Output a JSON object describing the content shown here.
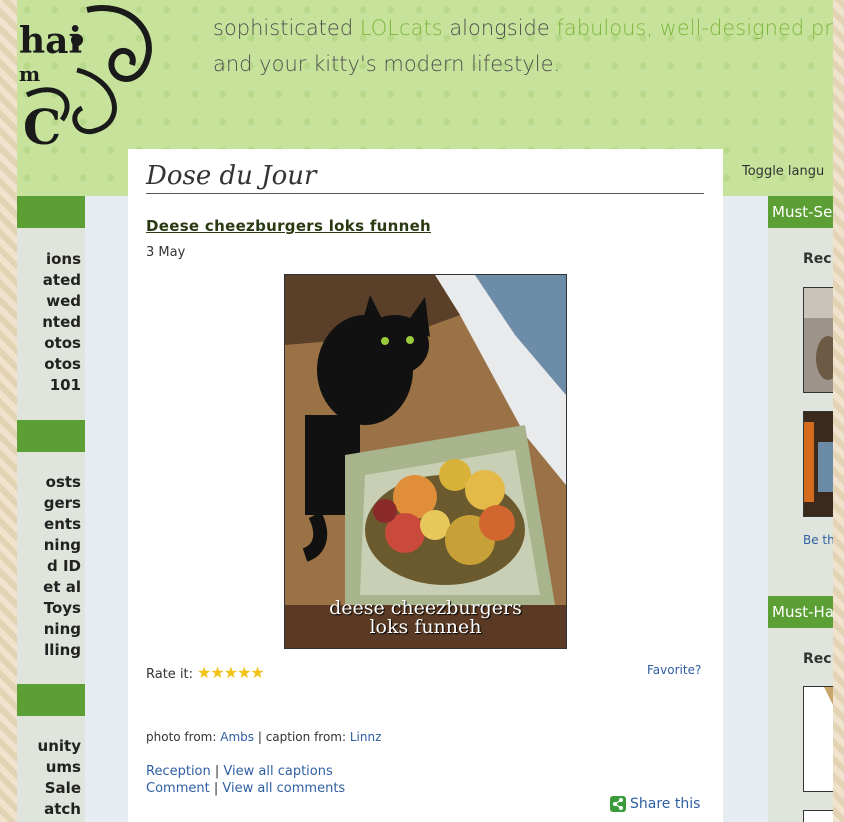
{
  "header": {
    "logo_text": "hai",
    "logo_text2": "m",
    "logo_letter": "C",
    "tagline_line1_a": "sophisticated ",
    "tagline_line1_hl1": "LOLcats",
    "tagline_line1_b": " alongside ",
    "tagline_line1_hl2": "fabulous, well-designed pro",
    "tagline_line2": "and your kitty's modern lifestyle.",
    "toggle_language": "Toggle langu"
  },
  "left_sidebar": {
    "group1": [
      "ions",
      "ated",
      "wed",
      "nted",
      "otos",
      "otos",
      "101"
    ],
    "group2": [
      "osts",
      "gers",
      "ents",
      "ning",
      "d ID",
      "et al",
      "Toys",
      "ning",
      "lling"
    ],
    "group3": [
      "unity",
      "ums",
      "Sale",
      "atch"
    ]
  },
  "main": {
    "section_title": "Dose du Jour",
    "post_title": "Deese cheezburgers loks funneh",
    "post_date": "3 May",
    "photo_caption_line1": "deese cheezburgers",
    "photo_caption_line2": "loks funneh",
    "rate_label": "Rate it:",
    "stars": "★★★★★",
    "favorite": "Favorite?",
    "photo_from_label": "photo from:",
    "photo_from_user": "Ambs",
    "caption_from_label": "| caption from:",
    "caption_from_user": "Linnz",
    "reception": "Reception",
    "view_all_captions": "View all captions",
    "comment": "Comment",
    "view_all_comments": "View all comments",
    "share": "Share this"
  },
  "right_sidebar": {
    "bar1": "Must-Se",
    "label1": "Rec",
    "be_the": "Be th",
    "bar2": "Must-Ha",
    "label2": "Rec"
  },
  "colors": {
    "header_green": "#c7e39b",
    "bar_green": "#5c9f35",
    "highlight_green": "#7eb63d",
    "link_blue": "#2f5fa3",
    "star_gold": "#f2c21b"
  }
}
